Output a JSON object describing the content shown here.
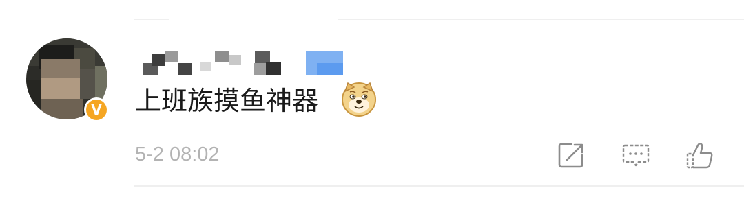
{
  "comment": {
    "text": "上班族摸鱼神器",
    "emoji": "doge-emoji",
    "timestamp": "5-2 08:02"
  },
  "user": {
    "verified_badge": "V",
    "verified_color": "#f5a623"
  },
  "actions": {
    "share_icon": "share-icon",
    "reply_icon": "comment-icon",
    "like_icon": "thumbs-up-icon"
  },
  "colors": {
    "text": "#1a1a1a",
    "muted": "#b3b3b3",
    "icon": "#8c8c8c"
  }
}
